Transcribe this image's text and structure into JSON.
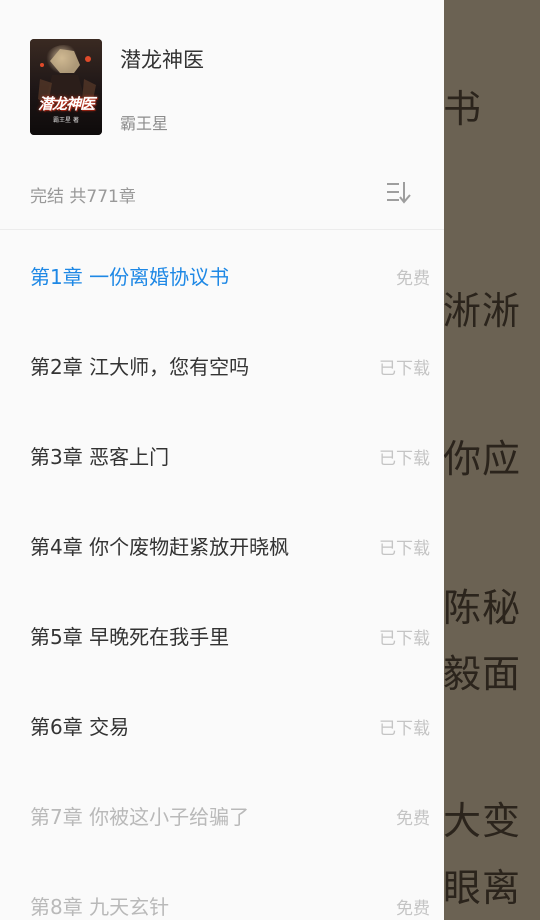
{
  "reader": {
    "visible_text": [
      "书",
      "淅淅",
      "你应",
      "陈秘",
      "毅面",
      "大变",
      "眼离"
    ]
  },
  "drawer": {
    "book": {
      "title": "潜龙神医",
      "author": "霸王星",
      "cover_text": "潜龙神医",
      "cover_subtext": "霸王星 著",
      "status": "完结 共771章"
    },
    "sort_icon": "sort-descending-icon",
    "chapters": [
      {
        "title": "第1章 一份离婚协议书",
        "status": "免费",
        "state": "current"
      },
      {
        "title": "第2章 江大师，您有空吗",
        "status": "已下载",
        "state": "downloaded"
      },
      {
        "title": "第3章 恶客上门",
        "status": "已下载",
        "state": "downloaded"
      },
      {
        "title": "第4章 你个废物赶紧放开晓枫",
        "status": "已下载",
        "state": "downloaded"
      },
      {
        "title": "第5章 早晚死在我手里",
        "status": "已下载",
        "state": "downloaded"
      },
      {
        "title": "第6章 交易",
        "status": "已下载",
        "state": "downloaded"
      },
      {
        "title": "第7章 你被这小子给骗了",
        "status": "免费",
        "state": "locked"
      },
      {
        "title": "第8章 九天玄针",
        "status": "免费",
        "state": "locked"
      }
    ]
  },
  "colors": {
    "accent": "#1e88e5",
    "reader_overlay": "#6b6253"
  }
}
